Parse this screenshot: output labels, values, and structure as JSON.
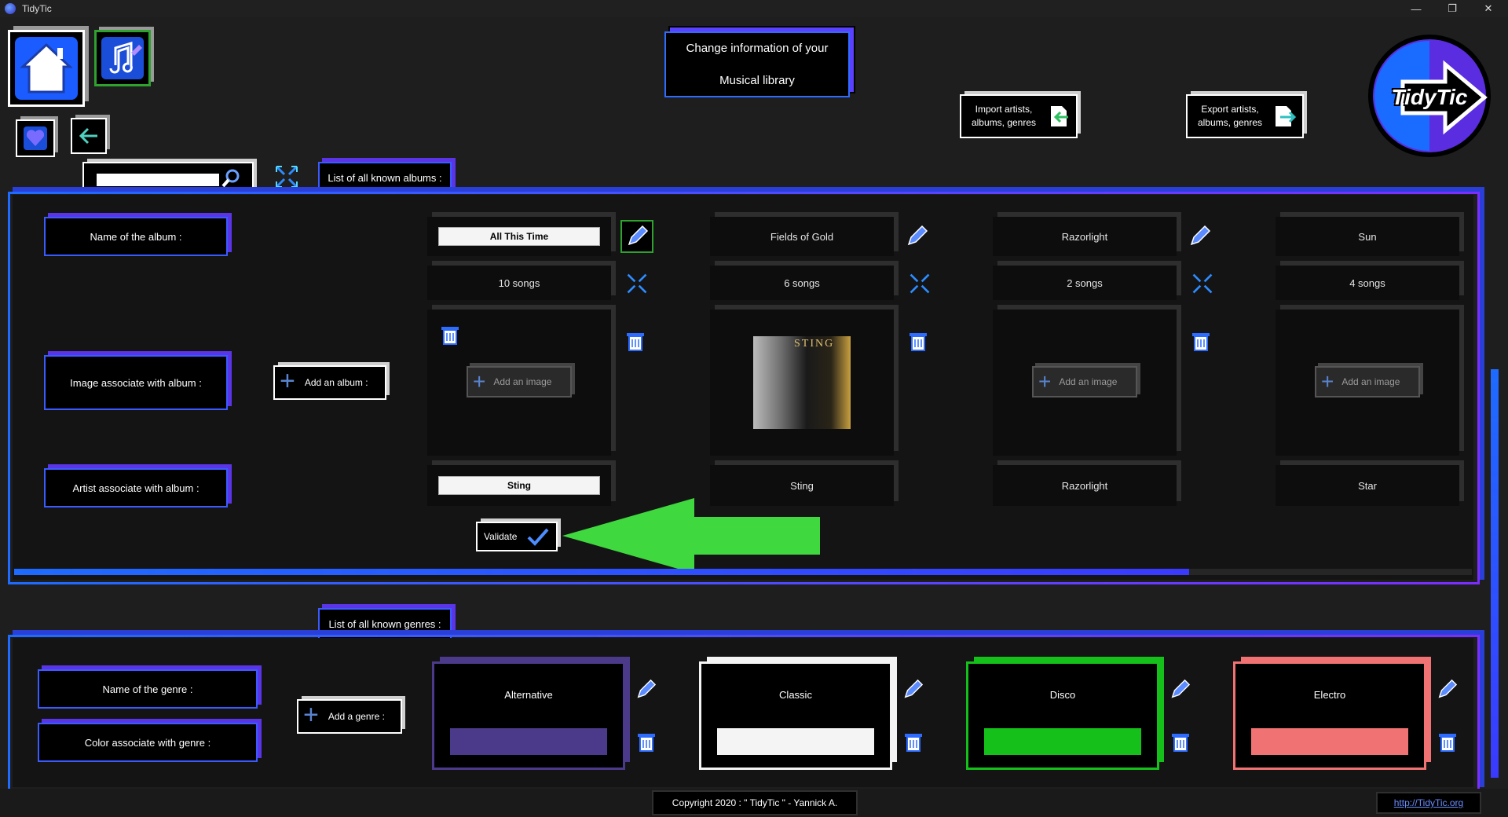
{
  "window": {
    "title": "TidyTic",
    "min": "—",
    "max": "❐",
    "close": "✕"
  },
  "header": {
    "title_line1": "Change information of your",
    "title_line2": "Musical library",
    "import_label_1": "Import artists,",
    "import_label_2": "albums, genres",
    "export_label_1": "Export artists,",
    "export_label_2": "albums, genres",
    "logo_text": "TidyTic"
  },
  "search": {
    "placeholder": "",
    "value": ""
  },
  "albums_section": {
    "title": "List of all known albums :",
    "row_labels": {
      "name": "Name of the album :",
      "image": "Image associate with album :",
      "artist": "Artist associate with album :"
    },
    "add_album_label": "Add an album :",
    "add_image_label": "Add an image",
    "validate_label": "Validate",
    "albums": [
      {
        "name": "All This Time",
        "songs": "10 songs",
        "artist": "Sting",
        "has_image": false,
        "editing": true
      },
      {
        "name": "Fields of Gold",
        "songs": "6 songs",
        "artist": "Sting",
        "has_image": true,
        "cover_text": "STING",
        "editing": false
      },
      {
        "name": "Razorlight",
        "songs": "2 songs",
        "artist": "Razorlight",
        "has_image": false,
        "editing": false
      },
      {
        "name": "Sun",
        "songs": "4 songs",
        "artist": "Star",
        "has_image": false,
        "editing": false
      }
    ]
  },
  "genres_section": {
    "title": "List of all known genres :",
    "row_labels": {
      "name": "Name of the genre :",
      "color": "Color associate with genre :"
    },
    "add_genre_label": "Add a genre :",
    "genres": [
      {
        "name": "Alternative",
        "color": "#4b3a8a"
      },
      {
        "name": "Classic",
        "color": "#f4f4f4"
      },
      {
        "name": "Disco",
        "color": "#15c01a"
      },
      {
        "name": "Electro",
        "color": "#f07272"
      }
    ]
  },
  "footer": {
    "copyright": "Copyright 2020 : \" TidyTic \" - Yannick A.",
    "link": "http://TidyTic.org"
  },
  "colors": {
    "accent_blue": "#1e6bff",
    "accent_purple": "#6a2dff",
    "arrow_green": "#3fd83f"
  }
}
